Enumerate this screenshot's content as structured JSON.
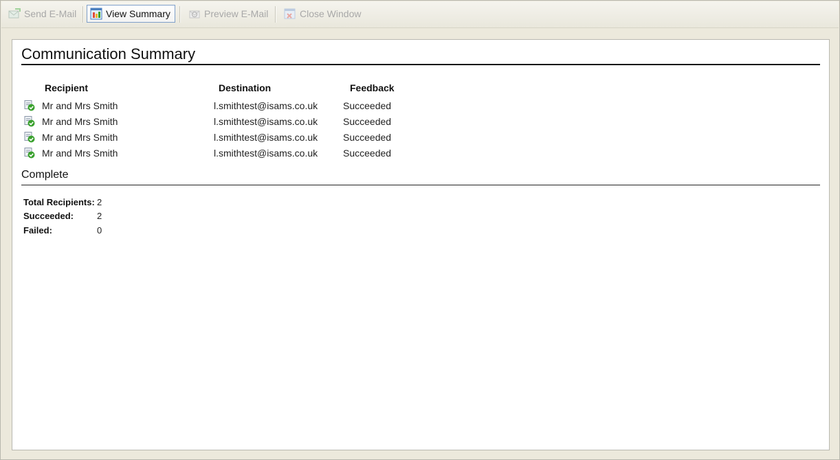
{
  "toolbar": {
    "send_email": "Send E-Mail",
    "view_summary": "View Summary",
    "preview_email": "Preview E-Mail",
    "close_window": "Close Window"
  },
  "summary": {
    "title": "Communication Summary",
    "columns": {
      "recipient": "Recipient",
      "destination": "Destination",
      "feedback": "Feedback"
    },
    "rows": [
      {
        "recipient": "Mr and Mrs Smith",
        "destination": "l.smithtest@isams.co.uk",
        "feedback": "Succeeded",
        "icon": "recipient-success-icon"
      },
      {
        "recipient": "Mr and Mrs Smith",
        "destination": "l.smithtest@isams.co.uk",
        "feedback": "Succeeded",
        "icon": "recipient-success-icon"
      },
      {
        "recipient": "Mr and Mrs Smith",
        "destination": "l.smithtest@isams.co.uk",
        "feedback": "Succeeded",
        "icon": "recipient-success-icon"
      },
      {
        "recipient": "Mr and Mrs Smith",
        "destination": "l.smithtest@isams.co.uk",
        "feedback": "Succeeded",
        "icon": "recipient-success-icon"
      }
    ]
  },
  "complete": {
    "title": "Complete",
    "total_label": "Total Recipients:",
    "total_value": "2",
    "succeeded_label": "Succeeded:",
    "succeeded_value": "2",
    "failed_label": "Failed:",
    "failed_value": "0"
  },
  "colors": {
    "success": "#3aa12e",
    "active_border": "#7e9fc9"
  }
}
